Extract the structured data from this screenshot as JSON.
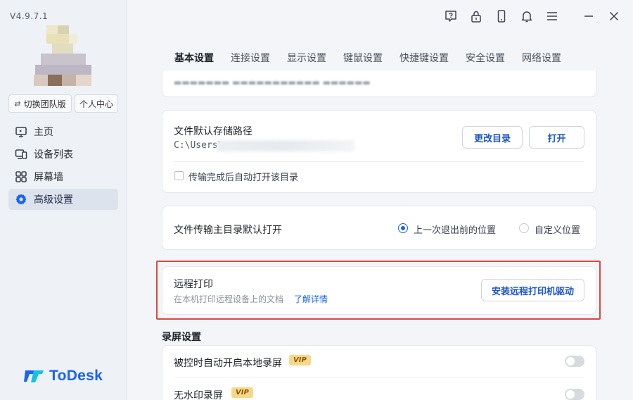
{
  "app": {
    "version": "V4.9.7.1",
    "logo_text": "ToDesk"
  },
  "sidebar": {
    "switch_team_label": "切换团队版",
    "user_center_label": "个人中心",
    "items": [
      {
        "label": "主页",
        "icon": "monitor-icon"
      },
      {
        "label": "设备列表",
        "icon": "device-list-icon"
      },
      {
        "label": "屏幕墙",
        "icon": "grid-icon"
      },
      {
        "label": "高级设置",
        "icon": "gear-icon",
        "active": true
      }
    ]
  },
  "toolbar": {
    "icons": [
      "help-icon",
      "lock-icon",
      "phone-icon",
      "bell-icon",
      "menu-icon",
      "minimize-icon",
      "close-icon"
    ]
  },
  "tabs": [
    {
      "label": "基本设置",
      "active": true
    },
    {
      "label": "连接设置"
    },
    {
      "label": "显示设置"
    },
    {
      "label": "键鼠设置"
    },
    {
      "label": "快捷键设置"
    },
    {
      "label": "安全设置"
    },
    {
      "label": "网络设置"
    }
  ],
  "storage": {
    "title": "文件默认存储路径",
    "path": "C:\\Users\\",
    "change_dir_label": "更改目录",
    "open_label": "打开",
    "auto_open_label": "传输完成后自动打开该目录"
  },
  "transfer": {
    "title": "文件传输主目录默认打开",
    "option_last": "上一次退出前的位置",
    "option_custom": "自定义位置"
  },
  "remote_print": {
    "title": "远程打印",
    "description": "在本机打印远程设备上的文档",
    "learn_more": "了解详情",
    "install_label": "安装远程打印机驱动"
  },
  "recording": {
    "section_title": "录屏设置",
    "auto_record_label": "被控时自动开启本地录屏",
    "no_watermark_label": "无水印录屏",
    "vip_label": "VIP"
  },
  "colors": {
    "accent": "#1a63f5",
    "highlight": "#e0473f",
    "vip_bg": "#f7d88a"
  }
}
